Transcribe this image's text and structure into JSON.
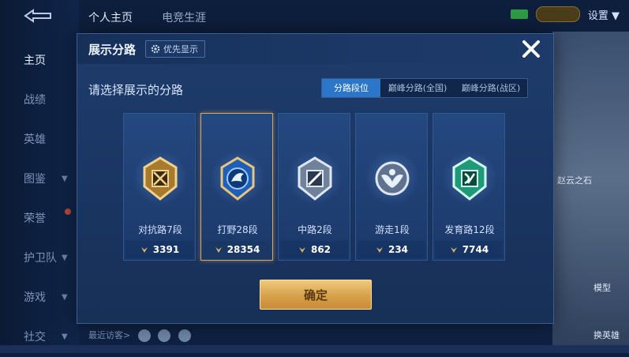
{
  "app": {
    "top_tabs": [
      "个人主页",
      "电竞生涯"
    ],
    "settings_label": "设置",
    "side_nav": [
      "主页",
      "战绩",
      "英雄",
      "图鉴",
      "荣誉",
      "护卫队",
      "游戏",
      "社交"
    ],
    "recent_visitors_label": "最近访客>",
    "right_labels": [
      "赵云之石",
      "模型",
      "换英雄"
    ]
  },
  "modal": {
    "title": "展示分路",
    "pref_button_label": "优先显示",
    "subtitle": "请选择展示的分路",
    "tabs": [
      {
        "label": "分路段位",
        "active": true
      },
      {
        "label": "巅峰分路(全国)",
        "active": false
      },
      {
        "label": "巅峰分路(战区)",
        "active": false
      }
    ],
    "cards": [
      {
        "label": "对抗路7段",
        "value": "3391",
        "emblem": "sword-emblem-icon",
        "color": "#d8b46a",
        "selected": false
      },
      {
        "label": "打野28段",
        "value": "28354",
        "emblem": "dragon-emblem-icon",
        "color": "#3d7fd6",
        "selected": true
      },
      {
        "label": "中路2段",
        "value": "862",
        "emblem": "staff-emblem-icon",
        "color": "#b9c7d8",
        "selected": false
      },
      {
        "label": "游走1段",
        "value": "234",
        "emblem": "wing-emblem-icon",
        "color": "#c8d6e6",
        "selected": false
      },
      {
        "label": "发育路12段",
        "value": "7744",
        "emblem": "bow-emblem-icon",
        "color": "#3fc7a0",
        "selected": false
      }
    ],
    "confirm_label": "确定",
    "accent": "#2b76c9",
    "gold": "#d7a04b"
  }
}
